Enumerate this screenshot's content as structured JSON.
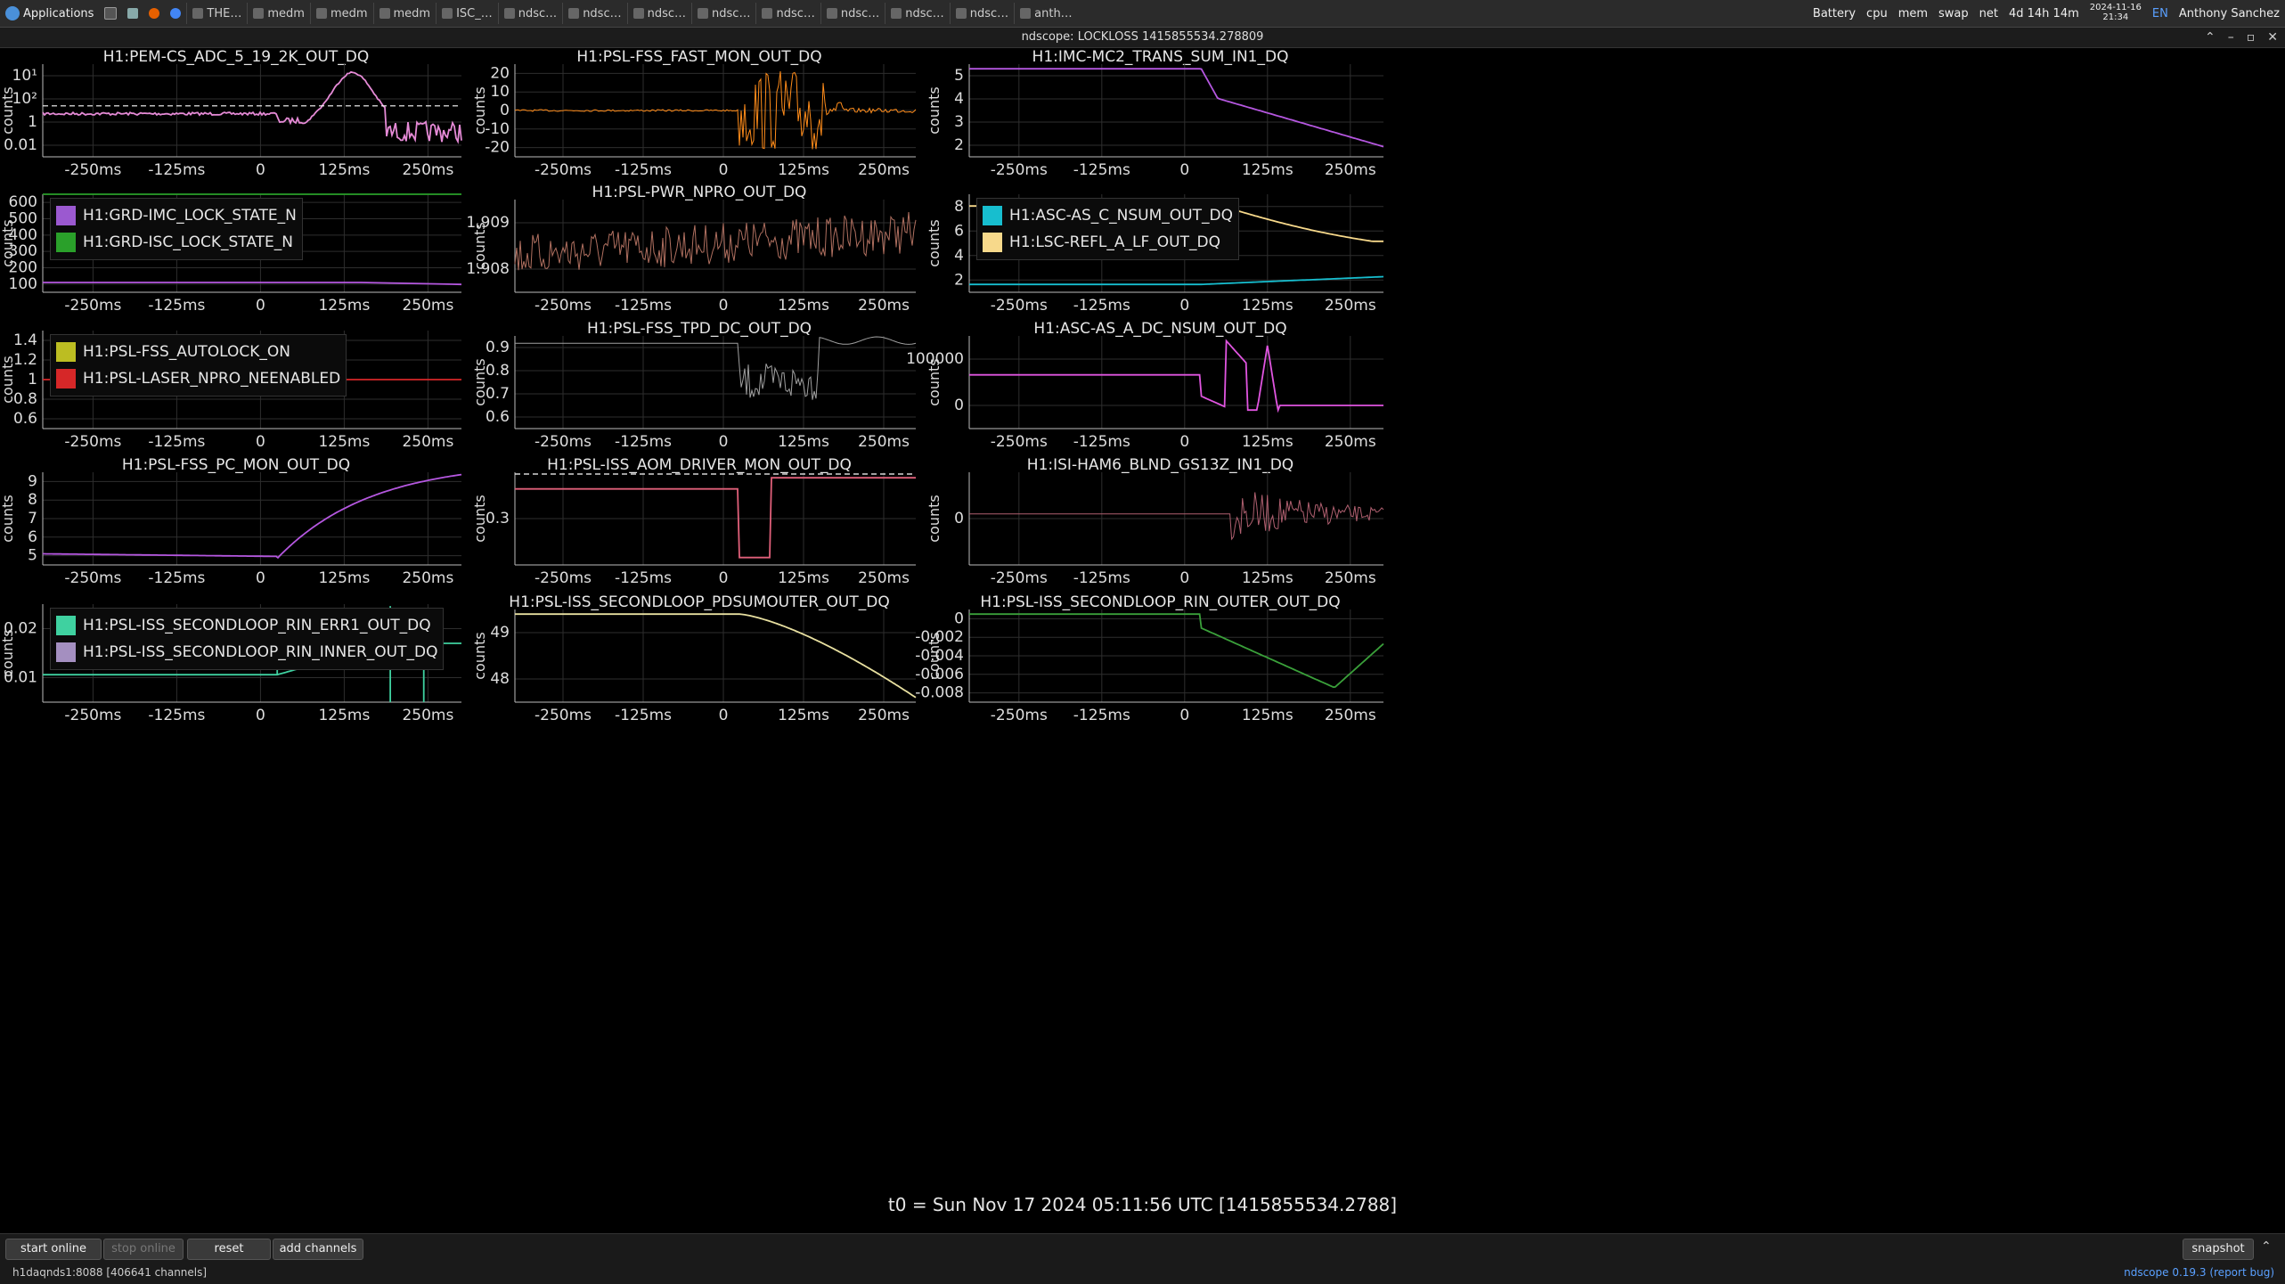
{
  "taskbar": {
    "apps_label": "Applications",
    "tasks": [
      "THE…",
      "medm",
      "medm",
      "medm",
      "ISC_…",
      "ndsc…",
      "ndsc…",
      "ndsc…",
      "ndsc…",
      "ndsc…",
      "ndsc…",
      "ndsc…",
      "ndsc…",
      "anth…"
    ],
    "battery": "Battery",
    "meters": [
      "cpu",
      "mem",
      "swap",
      "net"
    ],
    "uptime": "4d 14h 14m",
    "date": "2024-11-16",
    "time": "21:34",
    "lang": "EN",
    "user": "Anthony Sanchez"
  },
  "window": {
    "title": "ndscope: LOCKLOSS 1415855534.278809"
  },
  "colors": {
    "bg": "#000000",
    "grid": "#2e2e2e",
    "axis": "#bbbbbb"
  },
  "plots": [
    {
      "title": "H1:PEM-CS_ADC_5_19_2K_OUT_DQ",
      "ylabel": "counts",
      "yticks": [
        "10¹",
        "10²",
        "1",
        "0.01"
      ],
      "xticks": [
        "-250ms",
        "-125ms",
        "0",
        "125ms",
        "250ms"
      ],
      "legend": []
    },
    {
      "title": "H1:PSL-FSS_FAST_MON_OUT_DQ",
      "ylabel": "counts",
      "yticks": [
        "20",
        "10",
        "0",
        "-10",
        "-20"
      ],
      "xticks": [
        "-250ms",
        "-125ms",
        "0",
        "125ms",
        "250ms"
      ],
      "legend": []
    },
    {
      "title": "H1:IMC-MC2_TRANS_SUM_IN1_DQ",
      "ylabel": "counts",
      "yticks": [
        "5",
        "4",
        "3",
        "2"
      ],
      "xticks": [
        "-250ms",
        "-125ms",
        "0",
        "125ms",
        "250ms"
      ],
      "legend": []
    },
    {
      "title": "",
      "ylabel": "counts",
      "yticks": [
        "600",
        "500",
        "400",
        "300",
        "200",
        "100"
      ],
      "xticks": [
        "-250ms",
        "-125ms",
        "0",
        "125ms",
        "250ms"
      ],
      "legend": [
        {
          "name": "H1:GRD-IMC_LOCK_STATE_N",
          "color": "#9b59d0"
        },
        {
          "name": "H1:GRD-ISC_LOCK_STATE_N",
          "color": "#2aa02a"
        }
      ]
    },
    {
      "title": "H1:PSL-PWR_NPRO_OUT_DQ",
      "ylabel": "counts",
      "yticks": [
        "1.909",
        "1.908"
      ],
      "xticks": [
        "-250ms",
        "-125ms",
        "0",
        "125ms",
        "250ms"
      ],
      "legend": []
    },
    {
      "title": "",
      "ylabel": "counts",
      "yticks": [
        "8",
        "6",
        "4",
        "2"
      ],
      "xticks": [
        "-250ms",
        "-125ms",
        "0",
        "125ms",
        "250ms"
      ],
      "legend": [
        {
          "name": "H1:ASC-AS_C_NSUM_OUT_DQ",
          "color": "#17becf"
        },
        {
          "name": "H1:LSC-REFL_A_LF_OUT_DQ",
          "color": "#f7d98b"
        }
      ]
    },
    {
      "title": "",
      "ylabel": "counts",
      "yticks": [
        "1.4",
        "1.2",
        "1",
        "0.8",
        "0.6"
      ],
      "xticks": [
        "-250ms",
        "-125ms",
        "0",
        "125ms",
        "250ms"
      ],
      "legend": [
        {
          "name": "H1:PSL-FSS_AUTOLOCK_ON",
          "color": "#bcbd22"
        },
        {
          "name": "H1:PSL-LASER_NPRO_NEENABLED",
          "color": "#d62728"
        }
      ]
    },
    {
      "title": "H1:PSL-FSS_TPD_DC_OUT_DQ",
      "ylabel": "counts",
      "yticks": [
        "0.9",
        "0.8",
        "0.7",
        "0.6"
      ],
      "xticks": [
        "-250ms",
        "-125ms",
        "0",
        "125ms",
        "250ms"
      ],
      "legend": []
    },
    {
      "title": "H1:ASC-AS_A_DC_NSUM_OUT_DQ",
      "ylabel": "counts",
      "yticks": [
        "100000",
        "0"
      ],
      "xticks": [
        "-250ms",
        "-125ms",
        "0",
        "125ms",
        "250ms"
      ],
      "legend": []
    },
    {
      "title": "H1:PSL-FSS_PC_MON_OUT_DQ",
      "ylabel": "counts",
      "yticks": [
        "9",
        "8",
        "7",
        "6",
        "5"
      ],
      "xticks": [
        "-250ms",
        "-125ms",
        "0",
        "125ms",
        "250ms"
      ],
      "legend": []
    },
    {
      "title": "H1:PSL-ISS_AOM_DRIVER_MON_OUT_DQ",
      "ylabel": "counts",
      "yticks": [
        "0.3"
      ],
      "xticks": [
        "-250ms",
        "-125ms",
        "0",
        "125ms",
        "250ms"
      ],
      "legend": []
    },
    {
      "title": "H1:ISI-HAM6_BLND_GS13Z_IN1_DQ",
      "ylabel": "counts",
      "yticks": [
        "0"
      ],
      "xticks": [
        "-250ms",
        "-125ms",
        "0",
        "125ms",
        "250ms"
      ],
      "legend": []
    },
    {
      "title": "",
      "ylabel": "counts",
      "yticks": [
        "0.02",
        "0.01"
      ],
      "xticks": [
        "-250ms",
        "-125ms",
        "0",
        "125ms",
        "250ms"
      ],
      "legend": [
        {
          "name": "H1:PSL-ISS_SECONDLOOP_RIN_ERR1_OUT_DQ",
          "color": "#3fd1a0"
        },
        {
          "name": "H1:PSL-ISS_SECONDLOOP_RIN_INNER_OUT_DQ",
          "color": "#a48fc0"
        }
      ]
    },
    {
      "title": "H1:PSL-ISS_SECONDLOOP_PDSUMOUTER_OUT_DQ",
      "ylabel": "counts",
      "yticks": [
        "49",
        "48"
      ],
      "xticks": [
        "-250ms",
        "-125ms",
        "0",
        "125ms",
        "250ms"
      ],
      "legend": []
    },
    {
      "title": "H1:PSL-ISS_SECONDLOOP_RIN_OUTER_OUT_DQ",
      "ylabel": "counts",
      "yticks": [
        "0",
        "-0.002",
        "-0.004",
        "-0.006",
        "-0.008"
      ],
      "xticks": [
        "-250ms",
        "-125ms",
        "0",
        "125ms",
        "250ms"
      ],
      "legend": []
    }
  ],
  "t0_label": "t0 = Sun Nov 17 2024 05:11:56 UTC [1415855534.2788]",
  "buttons": {
    "start_online": "start online",
    "stop_online": "stop online",
    "reset": "reset",
    "add_channels": "add channels",
    "snapshot": "snapshot"
  },
  "status": {
    "server": "h1daqnds1:8088  [406641 channels]",
    "version": "ndscope 0.19.3",
    "report": "(report bug)"
  }
}
